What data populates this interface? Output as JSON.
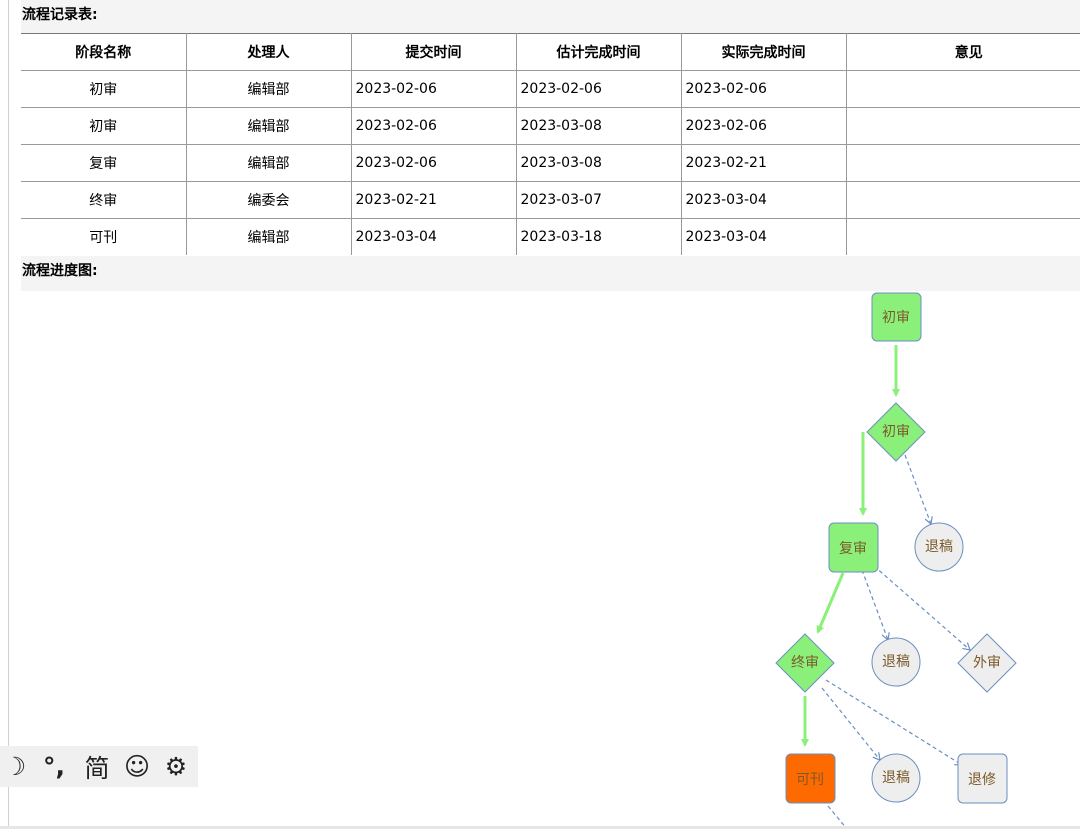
{
  "record": {
    "title": "流程记录表:",
    "columns": [
      "阶段名称",
      "处理人",
      "提交时间",
      "估计完成时间",
      "实际完成时间",
      "意见"
    ],
    "rows": [
      [
        "初审",
        "编辑部",
        "2023-02-06",
        "2023-02-06",
        "2023-02-06",
        ""
      ],
      [
        "初审",
        "编辑部",
        "2023-02-06",
        "2023-03-08",
        "2023-02-06",
        ""
      ],
      [
        "复审",
        "编辑部",
        "2023-02-06",
        "2023-03-08",
        "2023-02-21",
        ""
      ],
      [
        "终审",
        "编委会",
        "2023-02-21",
        "2023-03-07",
        "2023-03-04",
        ""
      ],
      [
        "可刊",
        "编辑部",
        "2023-03-04",
        "2023-03-18",
        "2023-03-04",
        ""
      ]
    ]
  },
  "progress": {
    "title": "流程进度图:",
    "nodes": {
      "first_review_box": "初审",
      "first_review_decision": "初审",
      "reject_1": "退稿",
      "second_review": "复审",
      "reject_2": "退稿",
      "external_review": "外审",
      "final_review": "终审",
      "reject_3": "退稿",
      "revise": "退修",
      "publishable": "可刊"
    },
    "colors": {
      "done_fill": "#8bf07a",
      "current_fill": "#ff6a00",
      "pending_fill": "#eeeeee",
      "node_stroke": "#6b8fc2",
      "done_arrow": "#8bf07a",
      "pending_arrow": "#6b8fc2",
      "label_text": "#7a5a2a"
    }
  },
  "ime_toolbar": {
    "moon_icon": "☽",
    "punct_icon": "°,",
    "simplified_label": "简",
    "emoji_icon": "☺",
    "settings_icon": "⚙"
  }
}
